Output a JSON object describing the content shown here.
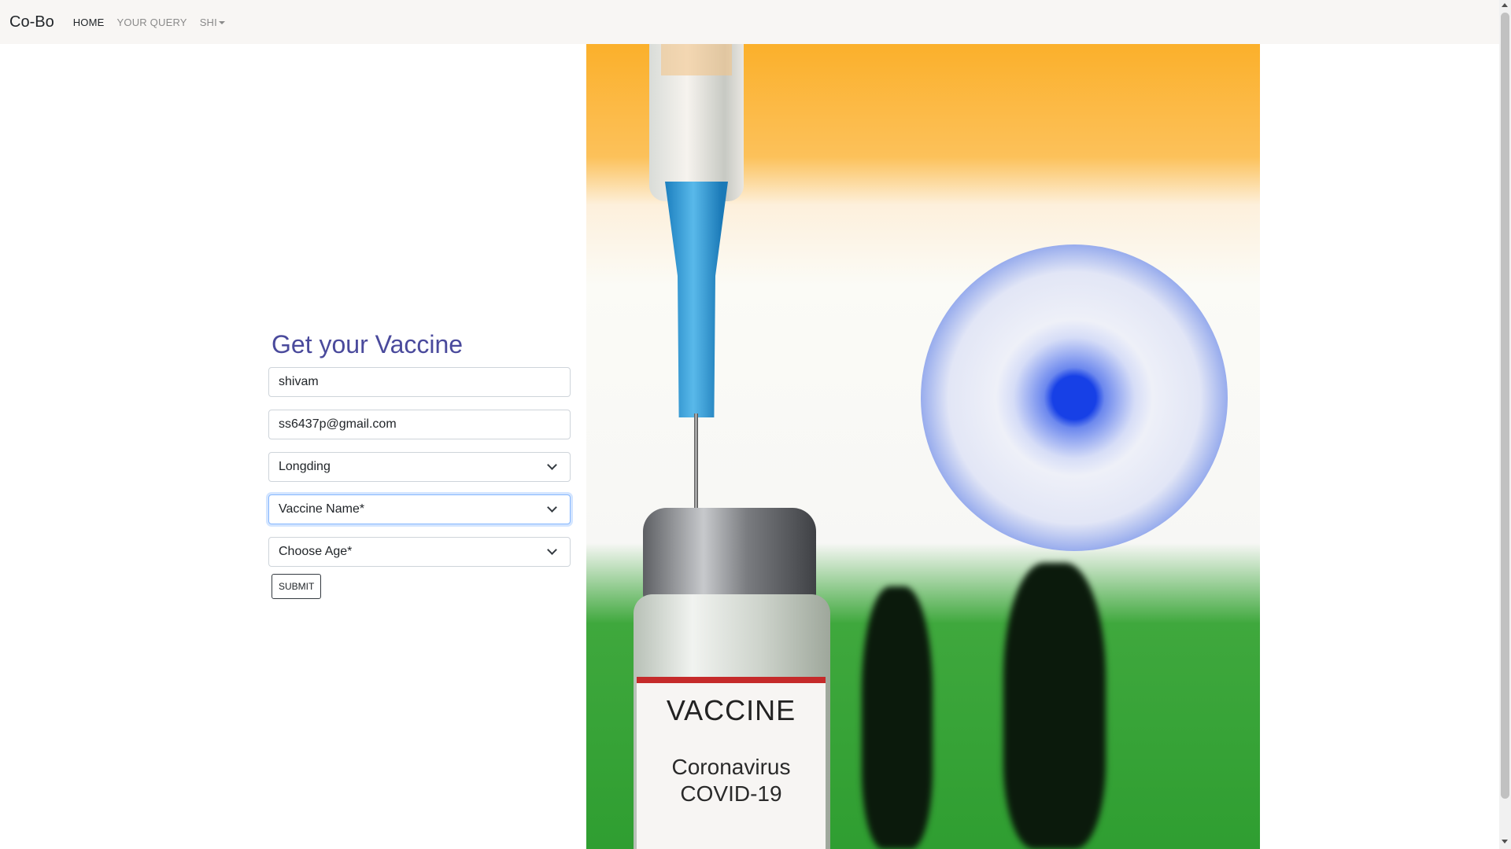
{
  "navbar": {
    "brand": "Co-Bo",
    "links": [
      {
        "label": "HOME",
        "active": true
      },
      {
        "label": "YOUR QUERY",
        "active": false
      },
      {
        "label": "SHI",
        "active": false,
        "dropdown": true
      }
    ]
  },
  "hero_image": {
    "label_title": "VACCINE",
    "label_line1": "Coronavirus",
    "label_line2": "COVID-19"
  },
  "form": {
    "title": "Get your Vaccine",
    "name_value": "shivam",
    "email_value": "ss6437p@gmail.com",
    "location_value": "Longding",
    "vaccine_placeholder": "Vaccine Name*",
    "age_placeholder": "Choose Age*",
    "submit_label": "SUBMIT"
  },
  "colors": {
    "title": "#4a4a9c",
    "focus_ring": "#86b7fe"
  }
}
